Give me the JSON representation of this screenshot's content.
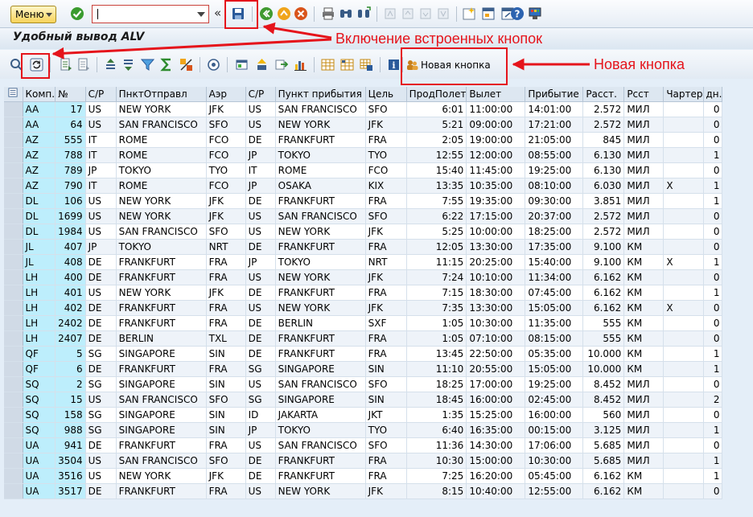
{
  "systembar": {
    "menu_label": "Меню",
    "command_value": ""
  },
  "title": "Удобный вывод ALV",
  "alv_toolbar": {
    "new_button_label": "Новая кнопка"
  },
  "annotations": {
    "builtin_buttons": "Включение встроенных кнопок",
    "new_button": "Новая кнопка",
    "color": "#e5141b"
  },
  "grid": {
    "columns": [
      "Комп.",
      "№",
      "С/Р",
      "ПнктОтправл",
      "Аэр",
      "С/Р",
      "Пункт прибытия",
      "Цель",
      "ПродПолет",
      "Вылет",
      "Прибытие",
      "Расст.",
      "Рсст",
      "Чартер",
      "дн."
    ],
    "rows": [
      [
        "AA",
        "17",
        "US",
        "NEW YORK",
        "JFK",
        "US",
        "SAN FRANCISCO",
        "SFO",
        "6:01",
        "11:00:00",
        "14:01:00",
        "2.572",
        "МИЛ",
        "",
        "0"
      ],
      [
        "AA",
        "64",
        "US",
        "SAN FRANCISCO",
        "SFO",
        "US",
        "NEW YORK",
        "JFK",
        "5:21",
        "09:00:00",
        "17:21:00",
        "2.572",
        "МИЛ",
        "",
        "0"
      ],
      [
        "AZ",
        "555",
        "IT",
        "ROME",
        "FCO",
        "DE",
        "FRANKFURT",
        "FRA",
        "2:05",
        "19:00:00",
        "21:05:00",
        "845",
        "МИЛ",
        "",
        "0"
      ],
      [
        "AZ",
        "788",
        "IT",
        "ROME",
        "FCO",
        "JP",
        "TOKYO",
        "TYO",
        "12:55",
        "12:00:00",
        "08:55:00",
        "6.130",
        "МИЛ",
        "",
        "1"
      ],
      [
        "AZ",
        "789",
        "JP",
        "TOKYO",
        "TYO",
        "IT",
        "ROME",
        "FCO",
        "15:40",
        "11:45:00",
        "19:25:00",
        "6.130",
        "МИЛ",
        "",
        "0"
      ],
      [
        "AZ",
        "790",
        "IT",
        "ROME",
        "FCO",
        "JP",
        "OSAKA",
        "KIX",
        "13:35",
        "10:35:00",
        "08:10:00",
        "6.030",
        "МИЛ",
        "X",
        "1"
      ],
      [
        "DL",
        "106",
        "US",
        "NEW YORK",
        "JFK",
        "DE",
        "FRANKFURT",
        "FRA",
        "7:55",
        "19:35:00",
        "09:30:00",
        "3.851",
        "МИЛ",
        "",
        "1"
      ],
      [
        "DL",
        "1699",
        "US",
        "NEW YORK",
        "JFK",
        "US",
        "SAN FRANCISCO",
        "SFO",
        "6:22",
        "17:15:00",
        "20:37:00",
        "2.572",
        "МИЛ",
        "",
        "0"
      ],
      [
        "DL",
        "1984",
        "US",
        "SAN FRANCISCO",
        "SFO",
        "US",
        "NEW YORK",
        "JFK",
        "5:25",
        "10:00:00",
        "18:25:00",
        "2.572",
        "МИЛ",
        "",
        "0"
      ],
      [
        "JL",
        "407",
        "JP",
        "TOKYO",
        "NRT",
        "DE",
        "FRANKFURT",
        "FRA",
        "12:05",
        "13:30:00",
        "17:35:00",
        "9.100",
        "КМ",
        "",
        "0"
      ],
      [
        "JL",
        "408",
        "DE",
        "FRANKFURT",
        "FRA",
        "JP",
        "TOKYO",
        "NRT",
        "11:15",
        "20:25:00",
        "15:40:00",
        "9.100",
        "КМ",
        "X",
        "1"
      ],
      [
        "LH",
        "400",
        "DE",
        "FRANKFURT",
        "FRA",
        "US",
        "NEW YORK",
        "JFK",
        "7:24",
        "10:10:00",
        "11:34:00",
        "6.162",
        "КМ",
        "",
        "0"
      ],
      [
        "LH",
        "401",
        "US",
        "NEW YORK",
        "JFK",
        "DE",
        "FRANKFURT",
        "FRA",
        "7:15",
        "18:30:00",
        "07:45:00",
        "6.162",
        "КМ",
        "",
        "1"
      ],
      [
        "LH",
        "402",
        "DE",
        "FRANKFURT",
        "FRA",
        "US",
        "NEW YORK",
        "JFK",
        "7:35",
        "13:30:00",
        "15:05:00",
        "6.162",
        "КМ",
        "X",
        "0"
      ],
      [
        "LH",
        "2402",
        "DE",
        "FRANKFURT",
        "FRA",
        "DE",
        "BERLIN",
        "SXF",
        "1:05",
        "10:30:00",
        "11:35:00",
        "555",
        "КМ",
        "",
        "0"
      ],
      [
        "LH",
        "2407",
        "DE",
        "BERLIN",
        "TXL",
        "DE",
        "FRANKFURT",
        "FRA",
        "1:05",
        "07:10:00",
        "08:15:00",
        "555",
        "КМ",
        "",
        "0"
      ],
      [
        "QF",
        "5",
        "SG",
        "SINGAPORE",
        "SIN",
        "DE",
        "FRANKFURT",
        "FRA",
        "13:45",
        "22:50:00",
        "05:35:00",
        "10.000",
        "КМ",
        "",
        "1"
      ],
      [
        "QF",
        "6",
        "DE",
        "FRANKFURT",
        "FRA",
        "SG",
        "SINGAPORE",
        "SIN",
        "11:10",
        "20:55:00",
        "15:05:00",
        "10.000",
        "КМ",
        "",
        "1"
      ],
      [
        "SQ",
        "2",
        "SG",
        "SINGAPORE",
        "SIN",
        "US",
        "SAN FRANCISCO",
        "SFO",
        "18:25",
        "17:00:00",
        "19:25:00",
        "8.452",
        "МИЛ",
        "",
        "0"
      ],
      [
        "SQ",
        "15",
        "US",
        "SAN FRANCISCO",
        "SFO",
        "SG",
        "SINGAPORE",
        "SIN",
        "18:45",
        "16:00:00",
        "02:45:00",
        "8.452",
        "МИЛ",
        "",
        "2"
      ],
      [
        "SQ",
        "158",
        "SG",
        "SINGAPORE",
        "SIN",
        "ID",
        "JAKARTA",
        "JKT",
        "1:35",
        "15:25:00",
        "16:00:00",
        "560",
        "МИЛ",
        "",
        "0"
      ],
      [
        "SQ",
        "988",
        "SG",
        "SINGAPORE",
        "SIN",
        "JP",
        "TOKYO",
        "TYO",
        "6:40",
        "16:35:00",
        "00:15:00",
        "3.125",
        "МИЛ",
        "",
        "1"
      ],
      [
        "UA",
        "941",
        "DE",
        "FRANKFURT",
        "FRA",
        "US",
        "SAN FRANCISCO",
        "SFO",
        "11:36",
        "14:30:00",
        "17:06:00",
        "5.685",
        "МИЛ",
        "",
        "0"
      ],
      [
        "UA",
        "3504",
        "US",
        "SAN FRANCISCO",
        "SFO",
        "DE",
        "FRANKFURT",
        "FRA",
        "10:30",
        "15:00:00",
        "10:30:00",
        "5.685",
        "МИЛ",
        "",
        "1"
      ],
      [
        "UA",
        "3516",
        "US",
        "NEW YORK",
        "JFK",
        "DE",
        "FRANKFURT",
        "FRA",
        "7:25",
        "16:20:00",
        "05:45:00",
        "6.162",
        "КМ",
        "",
        "1"
      ],
      [
        "UA",
        "3517",
        "DE",
        "FRANKFURT",
        "FRA",
        "US",
        "NEW YORK",
        "JFK",
        "8:15",
        "10:40:00",
        "12:55:00",
        "6.162",
        "КМ",
        "",
        "0"
      ]
    ]
  }
}
